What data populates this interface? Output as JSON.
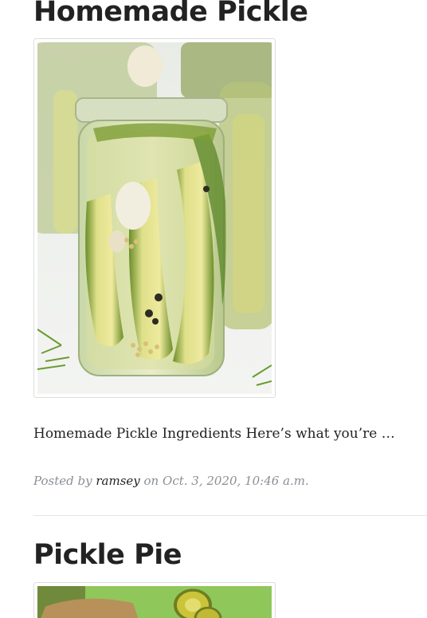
{
  "posts": [
    {
      "title": "Homemade Pickle",
      "image_alt": "jars of pickles with dill and garlic",
      "excerpt": "Homemade Pickle Ingredients Here’s what you’re …",
      "meta": {
        "posted_by": "Posted by",
        "author": "ramsey",
        "on": "on",
        "date": "Oct. 3, 2020, 10:46 a.m."
      }
    },
    {
      "title": "Pickle Pie",
      "image_alt": "pickle pie slice"
    }
  ],
  "colors": {
    "text": "#222222",
    "meta": "#8a8f95",
    "border": "#dddddd"
  }
}
